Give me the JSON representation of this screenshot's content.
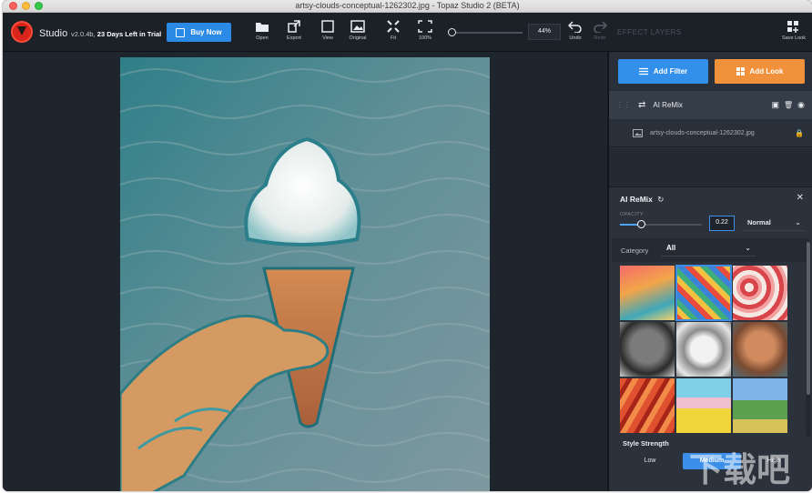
{
  "window": {
    "title": "artsy-clouds-conceptual-1262302.jpg - Topaz Studio 2 (BETA)"
  },
  "toolbar": {
    "brand": "Studio",
    "version": "v2.0.4b,",
    "trial": "23 Days Left in Trial",
    "buy_label": "Buy Now",
    "tools": [
      {
        "label": "Open",
        "icon": "folder-icon"
      },
      {
        "label": "Export",
        "icon": "export-icon"
      },
      {
        "label": "View",
        "icon": "view-icon"
      },
      {
        "label": "Original",
        "icon": "image-icon"
      },
      {
        "label": "Fit",
        "icon": "fit-icon"
      },
      {
        "label": "100%",
        "icon": "fullsize-icon"
      },
      {
        "label": "Undo",
        "icon": "undo-icon"
      },
      {
        "label": "Redo",
        "icon": "redo-icon"
      },
      {
        "label": "Save Look",
        "icon": "save-look-icon"
      }
    ],
    "zoom": "44%",
    "effect_layers": "EFFECT LAYERS"
  },
  "panel": {
    "add_filter": "Add Filter",
    "add_look": "Add Look",
    "layers": [
      {
        "name": "AI ReMix"
      },
      {
        "name": "artsy-clouds-conceptual-1262302.jpg"
      }
    ],
    "settings": {
      "title": "AI ReMix",
      "opacity_label": "OPACITY",
      "opacity_value": "0.22",
      "blend_mode": "Normal",
      "category_label": "Category",
      "category_value": "All",
      "style_strength_label": "Style Strength",
      "strength_options": [
        "Low",
        "Medium",
        "High"
      ],
      "strength_selected": "Medium"
    }
  },
  "watermark": "下载吧"
}
